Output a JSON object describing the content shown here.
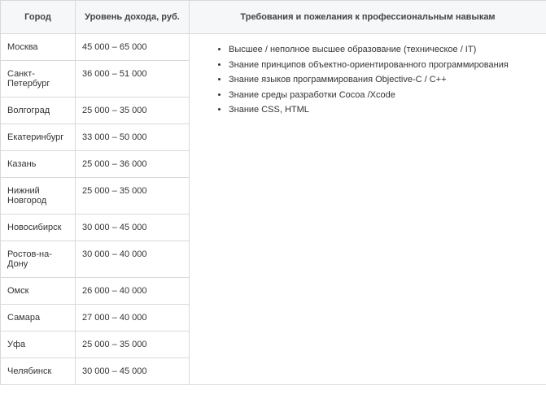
{
  "headers": {
    "city": "Город",
    "income": "Уровень дохода, руб.",
    "requirements": "Требования и пожелания к профессиональным навыкам"
  },
  "rows": [
    {
      "city": "Москва",
      "income": "45 000 – 65 000"
    },
    {
      "city": "Санкт-Петербург",
      "income": "36 000 – 51 000"
    },
    {
      "city": "Волгоград",
      "income": "25 000 – 35 000"
    },
    {
      "city": "Екатеринбург",
      "income": "33 000 – 50 000"
    },
    {
      "city": "Казань",
      "income": "25 000 – 36 000"
    },
    {
      "city": "Нижний Новгород",
      "income": "25 000 – 35 000"
    },
    {
      "city": "Новосибирск",
      "income": "30 000 – 45 000"
    },
    {
      "city": "Ростов-на-Дону",
      "income": "30 000 – 40 000"
    },
    {
      "city": "Омск",
      "income": "26 000 – 40 000"
    },
    {
      "city": "Самара",
      "income": "27 000 – 40 000"
    },
    {
      "city": "Уфа",
      "income": "25 000 – 35 000"
    },
    {
      "city": "Челябинск",
      "income": "30 000 – 45 000"
    }
  ],
  "requirements": [
    "Высшее / неполное высшее образование (техническое / IT)",
    "Знание принципов объектно-ориентированного программирования",
    "Знание языков программирования Objective-C / C++",
    "Знание среды разработки Cocoa /Xcode",
    "Знание CSS, HTML"
  ]
}
